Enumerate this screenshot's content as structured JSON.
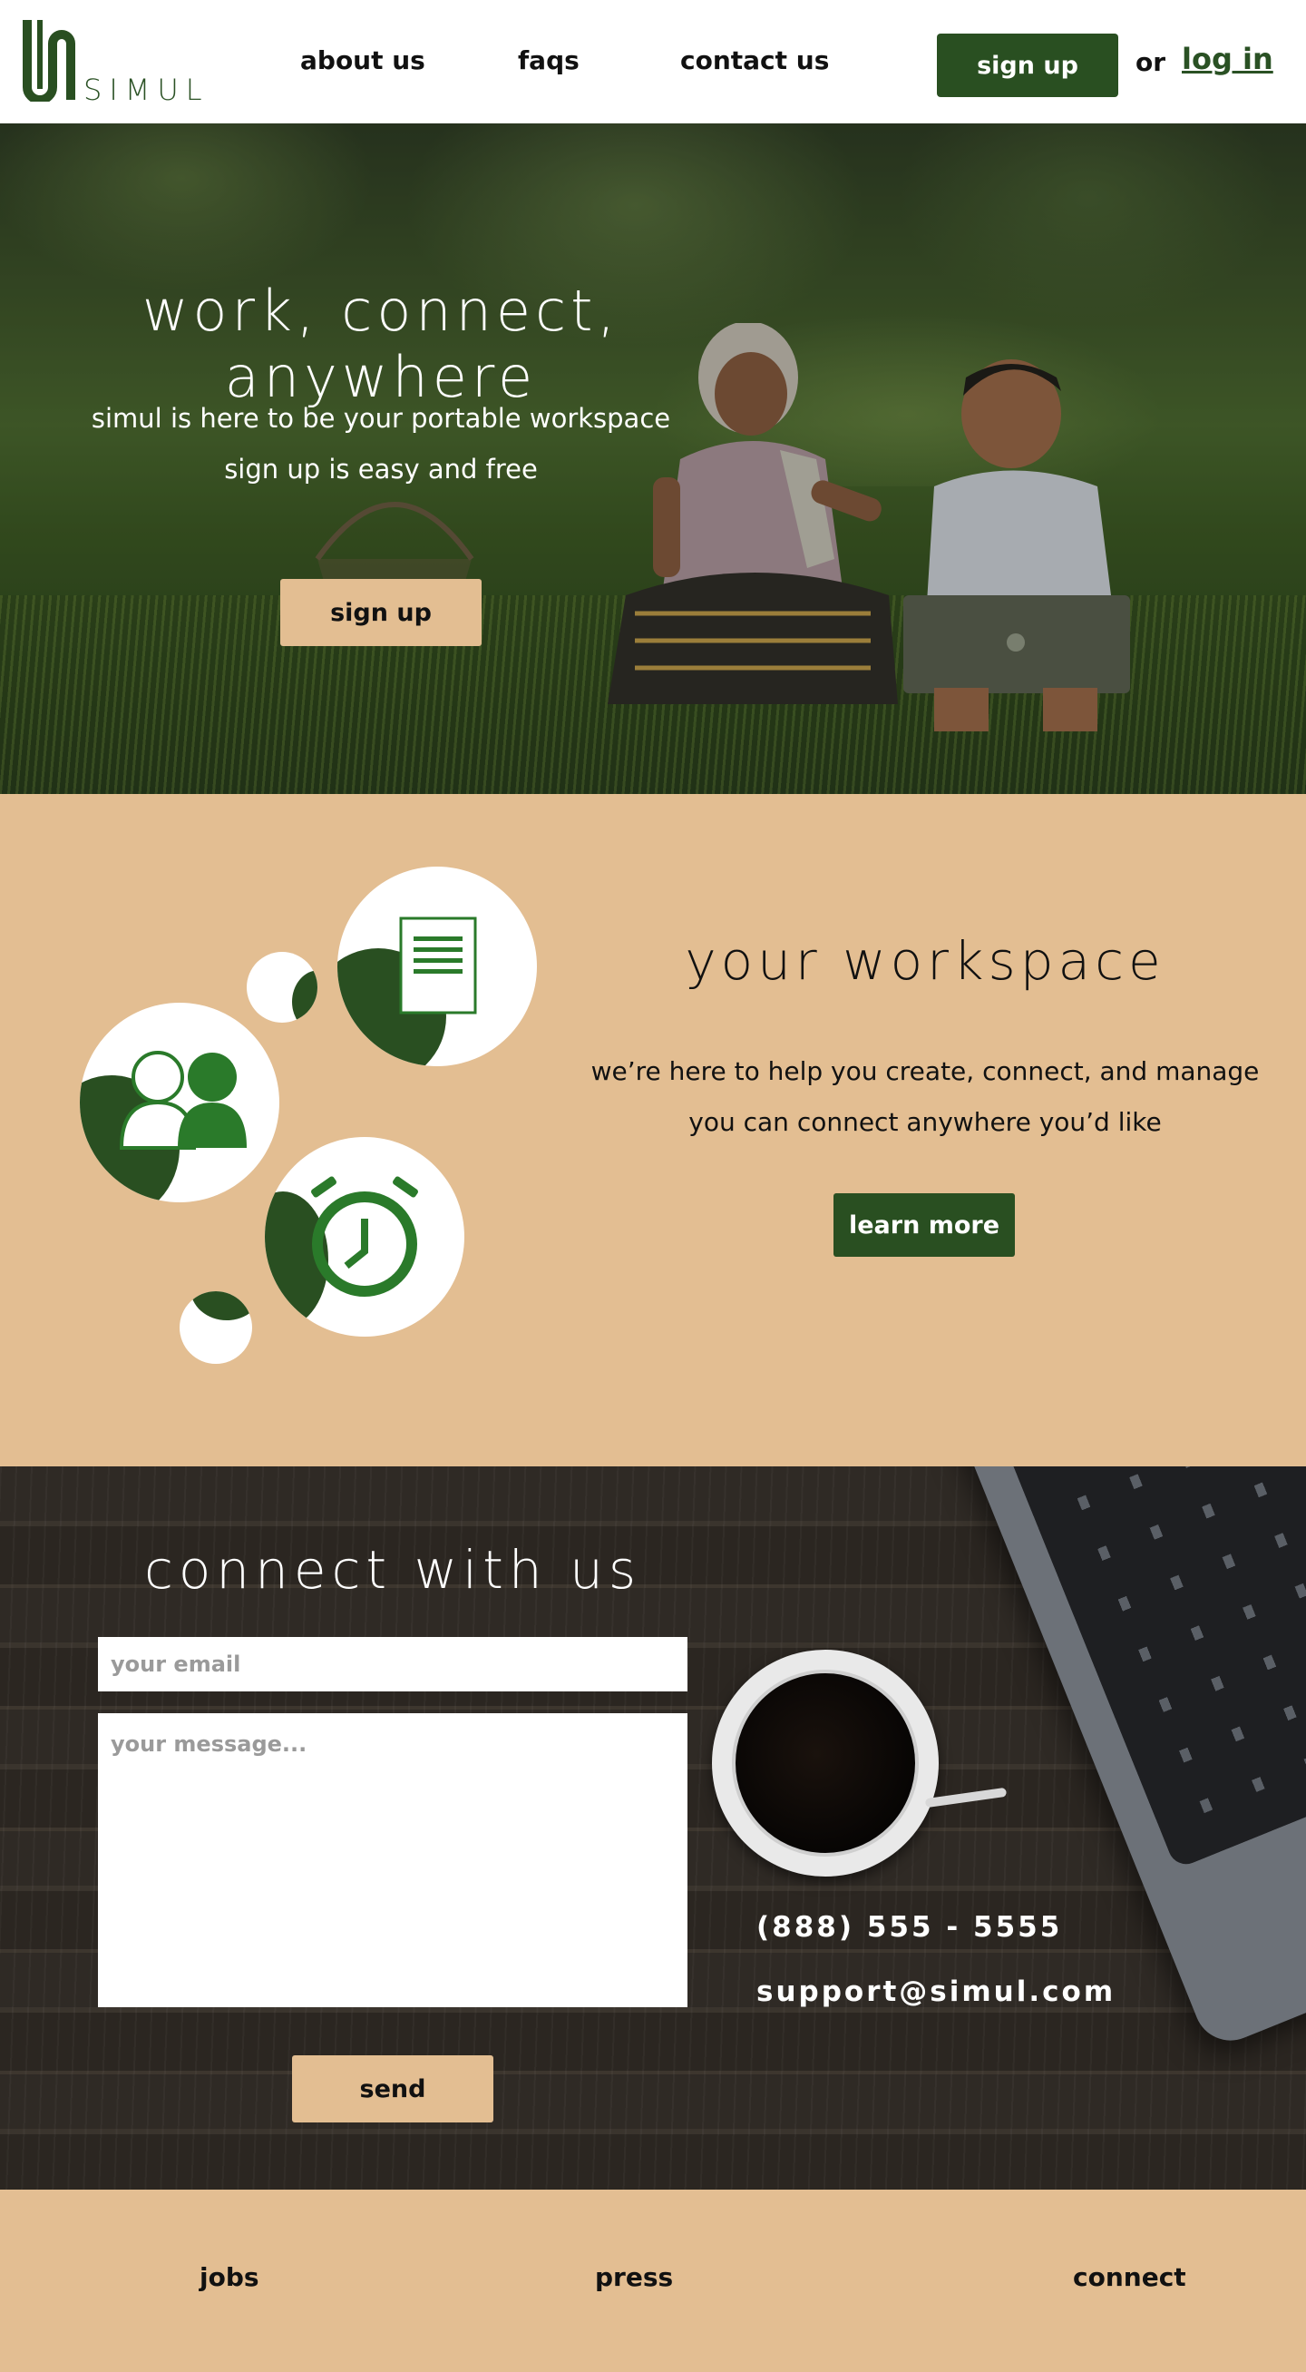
{
  "brand": {
    "name": "SIMUL",
    "accent": "#294f21",
    "sand": "#e3be92"
  },
  "nav": {
    "items": [
      "about us",
      "faqs",
      "contact us"
    ],
    "signup_label": "sign up",
    "or_label": "or",
    "login_label": "log in"
  },
  "hero": {
    "title": "work, connect, anywhere",
    "lines": [
      "simul is here to be your portable workspace",
      "sign up is easy and free"
    ],
    "button_label": "sign up"
  },
  "workspace": {
    "title": "your workspace",
    "lines": [
      "we’re here to help you create, connect, and manage",
      "you can connect anywhere you’d like"
    ],
    "button_label": "learn more",
    "icons": [
      "document-icon",
      "users-icon",
      "alarm-clock-icon"
    ]
  },
  "connect": {
    "title": "connect with us",
    "email_placeholder": "your email",
    "message_placeholder": "your message...",
    "send_label": "send",
    "phone": "(888) 555 - 5555",
    "email": "support@simul.com"
  },
  "footer": {
    "links": [
      "jobs",
      "press",
      "connect"
    ]
  }
}
